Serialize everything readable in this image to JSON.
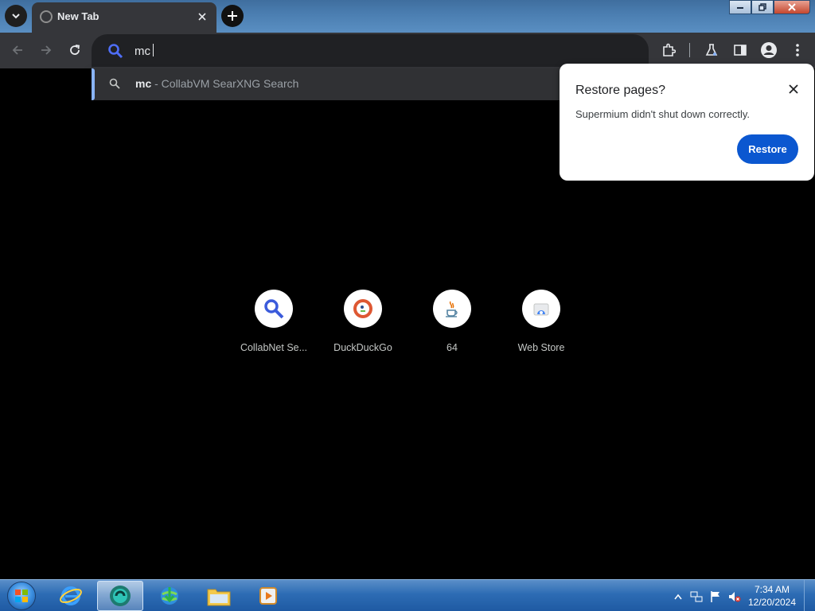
{
  "browser": {
    "tab": {
      "title": "New Tab"
    },
    "omnibox": {
      "value": "mc"
    },
    "suggestion": {
      "query": "mc",
      "rest": " - CollabVM SearXNG Search"
    }
  },
  "restore_bubble": {
    "title": "Restore pages?",
    "message": "Supermium didn't shut down correctly.",
    "button": "Restore"
  },
  "shortcuts": [
    {
      "label": "CollabNet Se...",
      "icon": "search-magnifier-icon"
    },
    {
      "label": "DuckDuckGo",
      "icon": "duckduckgo-icon"
    },
    {
      "label": "64",
      "icon": "java-icon"
    },
    {
      "label": "Web Store",
      "icon": "web-store-icon"
    }
  ],
  "taskbar": {
    "clock": {
      "time": "7:34 AM",
      "date": "12/20/2024"
    }
  },
  "colors": {
    "accent": "#0b57d0",
    "toolbar": "#35363a",
    "omnibox": "#202124"
  }
}
